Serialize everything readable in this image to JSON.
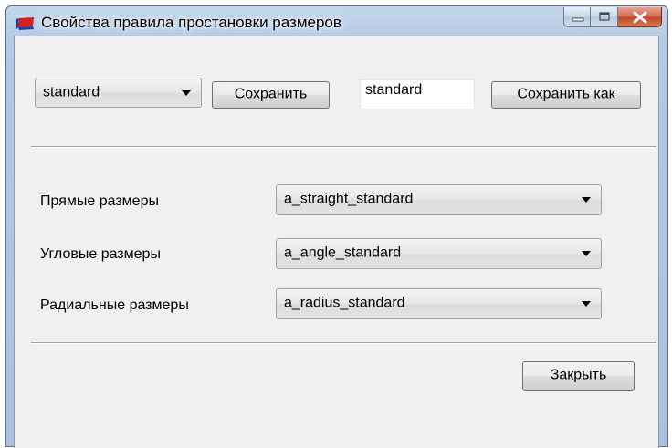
{
  "window": {
    "title": "Свойства правила простановки размеров"
  },
  "toolbar": {
    "style_select_value": "standard",
    "save_label": "Сохранить",
    "name_input_value": "standard",
    "save_as_label": "Сохранить как"
  },
  "rules": [
    {
      "label": "Прямые размеры",
      "value": "a_straight_standard"
    },
    {
      "label": "Угловые размеры",
      "value": "a_angle_standard"
    },
    {
      "label": "Радиальные размеры",
      "value": "a_radius_standard"
    }
  ],
  "footer": {
    "close_label": "Закрыть"
  }
}
